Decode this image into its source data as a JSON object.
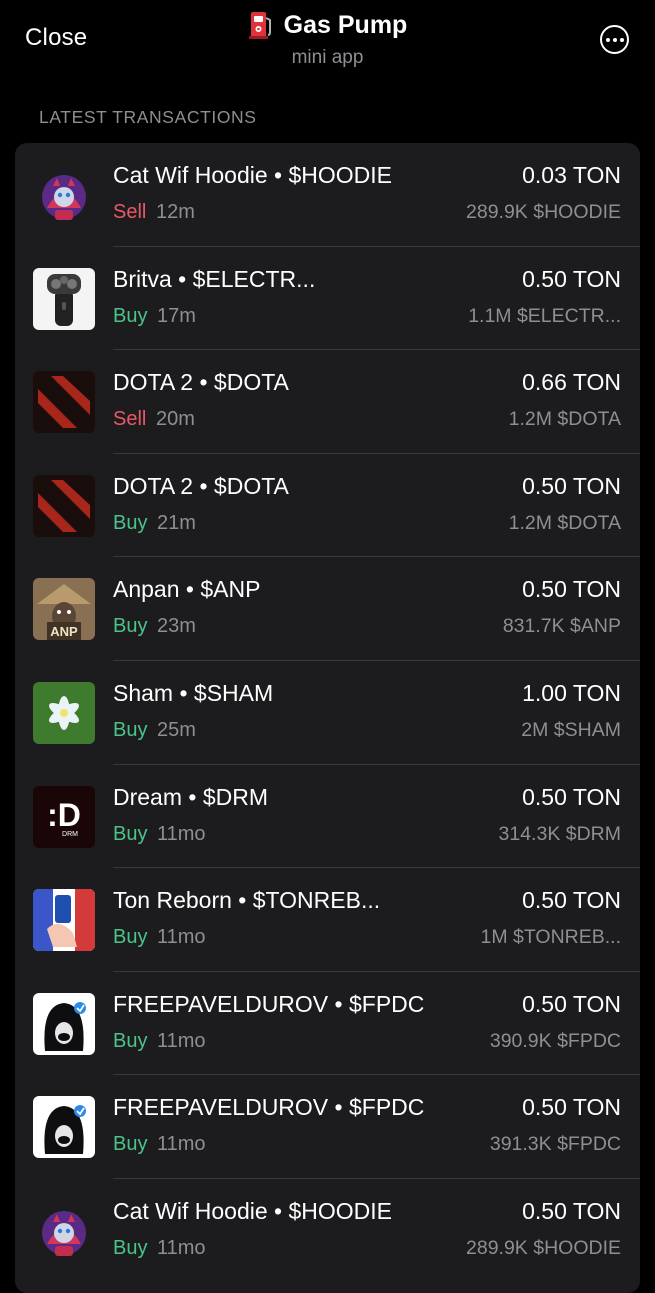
{
  "header": {
    "close_label": "Close",
    "title": "Gas Pump",
    "subtitle": "mini app",
    "more_icon": "more-icon"
  },
  "section_label": "LATEST TRANSACTIONS",
  "colors": {
    "sell": "#eb5765",
    "buy": "#4cc38a",
    "card_bg": "#1c1c1e",
    "muted": "#8e8e93"
  },
  "transactions": [
    {
      "name": "Cat Wif Hoodie • $HOODIE",
      "side": "Sell",
      "time": "12m",
      "amount": "0.03 TON",
      "tokens": "289.9K $HOODIE",
      "icon": "cat-hoodie"
    },
    {
      "name": "Britva • $ELECTR...",
      "side": "Buy",
      "time": "17m",
      "amount": "0.50 TON",
      "tokens": "1.1M $ELECTR...",
      "icon": "razor"
    },
    {
      "name": "DOTA 2 • $DOTA",
      "side": "Sell",
      "time": "20m",
      "amount": "0.66 TON",
      "tokens": "1.2M $DOTA",
      "icon": "dota"
    },
    {
      "name": "DOTA 2 • $DOTA",
      "side": "Buy",
      "time": "21m",
      "amount": "0.50 TON",
      "tokens": "1.2M $DOTA",
      "icon": "dota"
    },
    {
      "name": "Anpan • $ANP",
      "side": "Buy",
      "time": "23m",
      "amount": "0.50 TON",
      "tokens": "831.7K $ANP",
      "icon": "anpan",
      "icon_text": "ANP"
    },
    {
      "name": "Sham • $SHAM",
      "side": "Buy",
      "time": "25m",
      "amount": "1.00 TON",
      "tokens": "2M $SHAM",
      "icon": "flower"
    },
    {
      "name": "Dream • $DRM",
      "side": "Buy",
      "time": "11mo",
      "amount": "0.50 TON",
      "tokens": "314.3K $DRM",
      "icon": "dream",
      "icon_text": ":D"
    },
    {
      "name": "Ton Reborn • $TONREB...",
      "side": "Buy",
      "time": "11mo",
      "amount": "0.50 TON",
      "tokens": "1M $TONREB...",
      "icon": "ton-reborn"
    },
    {
      "name": "FREEPAVELDUROV • $FPDC",
      "side": "Buy",
      "time": "11mo",
      "amount": "0.50 TON",
      "tokens": "390.9K $FPDC",
      "icon": "hooded-figure"
    },
    {
      "name": "FREEPAVELDUROV • $FPDC",
      "side": "Buy",
      "time": "11mo",
      "amount": "0.50 TON",
      "tokens": "391.3K $FPDC",
      "icon": "hooded-figure"
    },
    {
      "name": "Cat Wif Hoodie • $HOODIE",
      "side": "Buy",
      "time": "11mo",
      "amount": "0.50 TON",
      "tokens": "289.9K $HOODIE",
      "icon": "cat-hoodie"
    }
  ]
}
